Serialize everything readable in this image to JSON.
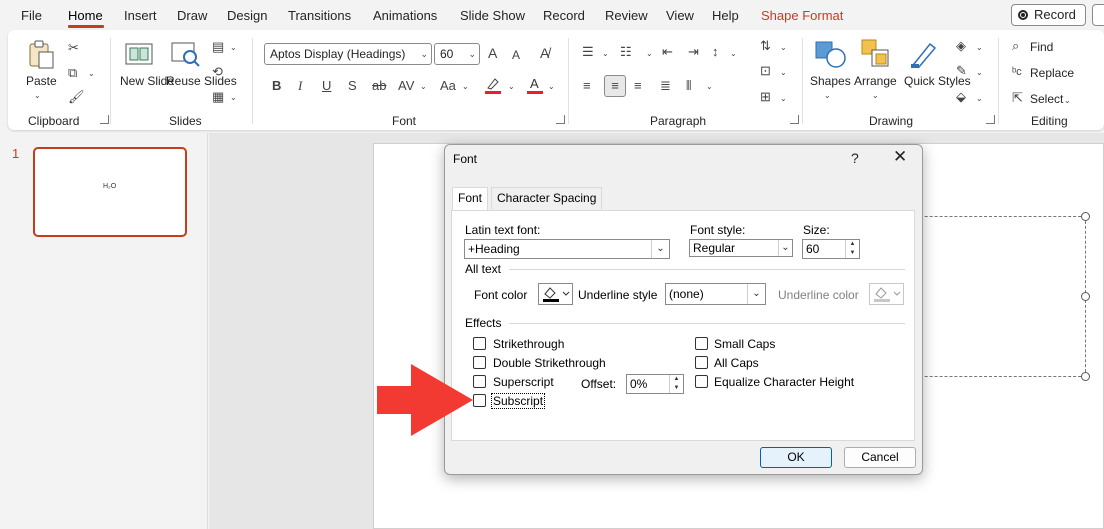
{
  "menu": {
    "items": [
      "File",
      "Home",
      "Insert",
      "Draw",
      "Design",
      "Transitions",
      "Animations",
      "Slide Show",
      "Record",
      "Review",
      "View",
      "Help",
      "Shape Format"
    ],
    "record_label": "Record"
  },
  "ribbon": {
    "clipboard": {
      "paste": "Paste",
      "label": "Clipboard"
    },
    "slides": {
      "new_slide": "New Slide",
      "reuse_slides": "Reuse Slides",
      "label": "Slides"
    },
    "font": {
      "font_name": "Aptos Display (Headings)",
      "font_size": "60",
      "label": "Font"
    },
    "paragraph": {
      "label": "Paragraph"
    },
    "drawing": {
      "shapes": "Shapes",
      "arrange": "Arrange",
      "quick_styles": "Quick Styles",
      "label": "Drawing"
    },
    "editing": {
      "find": "Find",
      "replace": "Replace",
      "select": "Select",
      "label": "Editing"
    }
  },
  "thumbnails": {
    "slide_number": "1",
    "thumb_text": "H₂O"
  },
  "dialog": {
    "title": "Font",
    "help": "?",
    "close": "✕",
    "tabs": [
      "Font",
      "Character Spacing"
    ],
    "latin_font_label": "Latin text font:",
    "latin_font_value": "+Heading",
    "font_style_label": "Font style:",
    "font_style_value": "Regular",
    "size_label": "Size:",
    "size_value": "60",
    "all_text_label": "All text",
    "font_color_label": "Font color",
    "underline_style_label": "Underline style",
    "underline_style_value": "(none)",
    "underline_color_label": "Underline color",
    "effects_label": "Effects",
    "effects_left": [
      "Strikethrough",
      "Double Strikethrough",
      "Superscript",
      "Subscript"
    ],
    "effects_right": [
      "Small Caps",
      "All Caps",
      "Equalize Character Height"
    ],
    "offset_label": "Offset:",
    "offset_value": "0%",
    "ok": "OK",
    "cancel": "Cancel"
  },
  "colors": {
    "accent": "#c43e1c",
    "arrow": "#f23a33"
  }
}
